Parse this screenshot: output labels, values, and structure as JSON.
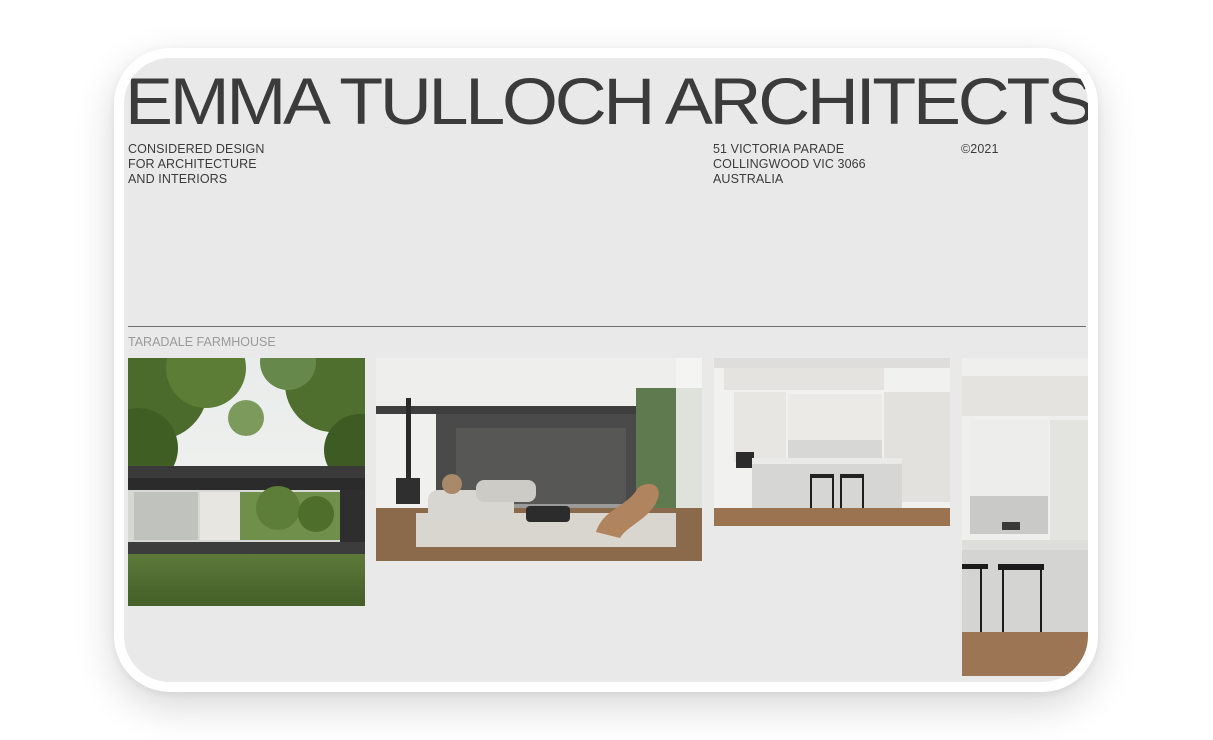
{
  "site": {
    "brand": "EMMA TULLOCH ARCHITECTS",
    "tagline_lines": [
      "CONSIDERED DESIGN",
      "FOR ARCHITECTURE",
      "AND INTERIORS"
    ],
    "address_lines": [
      "51 VICTORIA PARADE",
      "COLLINGWOOD VIC 3066",
      "AUSTRALIA"
    ],
    "copyright": "©2021"
  },
  "project": {
    "title": "TARADALE FARMHOUSE",
    "images": [
      {
        "name": "exterior-pavilion-photo"
      },
      {
        "name": "living-room-photo"
      },
      {
        "name": "kitchen-island-photo"
      },
      {
        "name": "kitchen-stools-photo"
      }
    ]
  },
  "colors": {
    "page_background": "#e9e9e9",
    "text": "#3b3b3b",
    "muted_text": "#9a9a9a",
    "rule": "#6f6f6f"
  }
}
